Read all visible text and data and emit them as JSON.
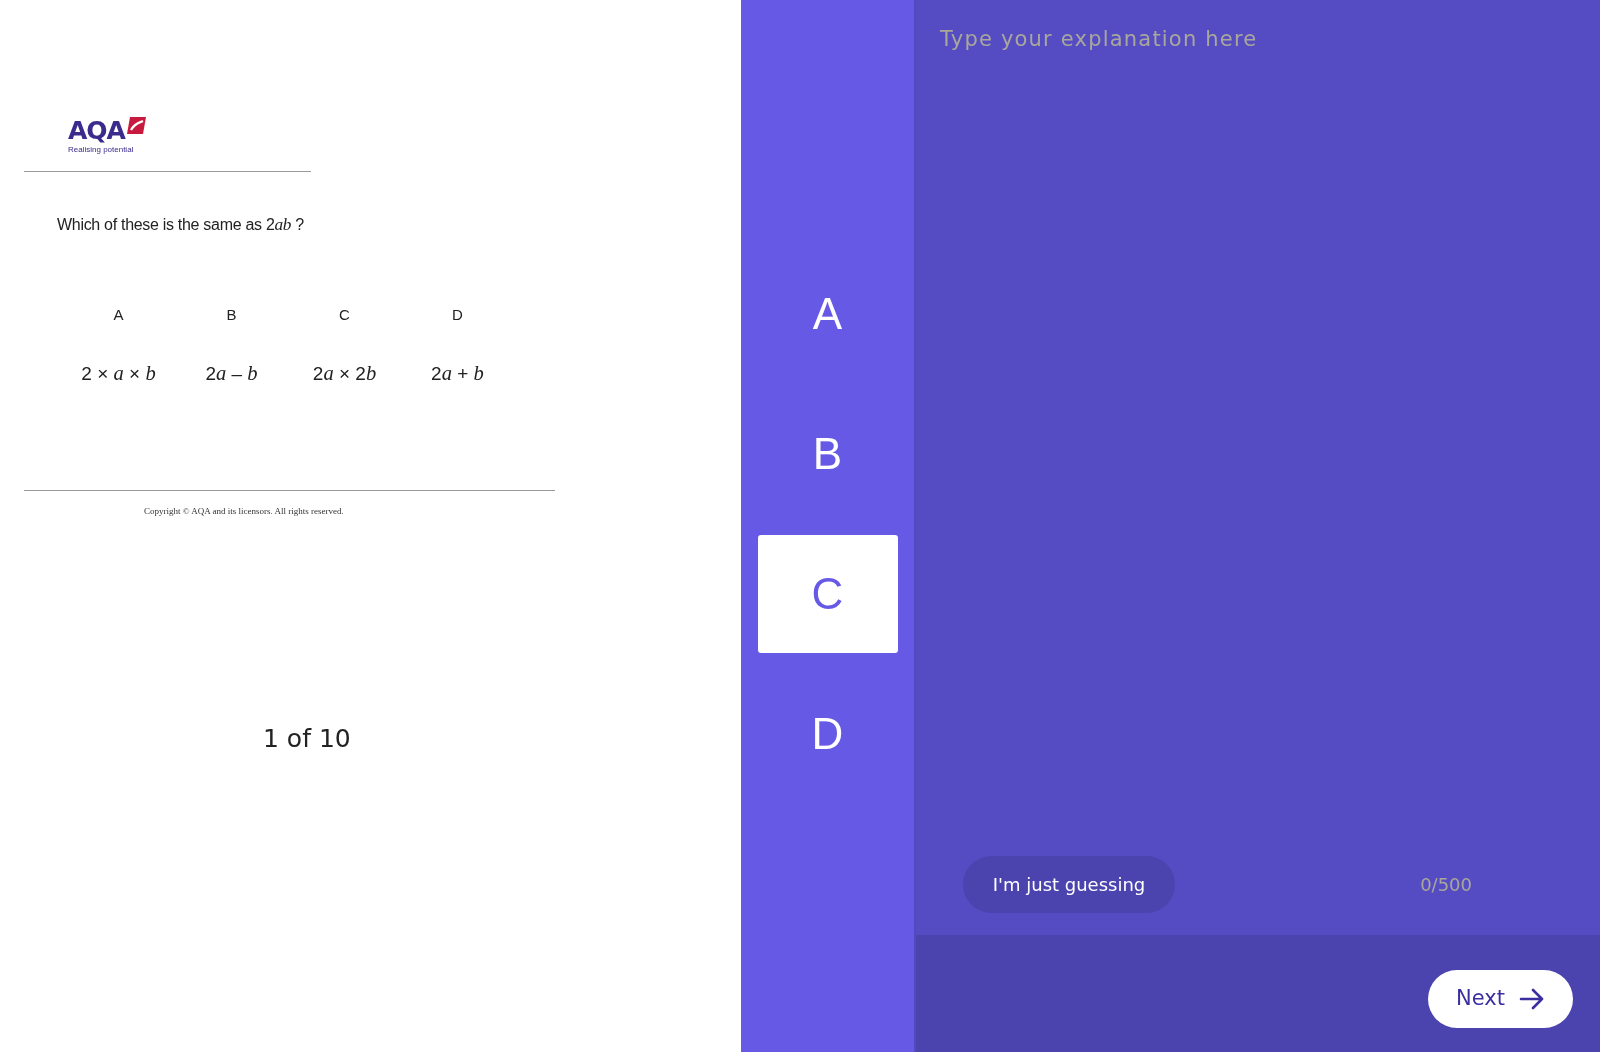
{
  "question_slide": {
    "logo": {
      "wordmark": "AQA",
      "tagline": "Realising potential"
    },
    "question": [
      {
        "text": "Which of these is the same as 2",
        "italic": false
      },
      {
        "text": "ab",
        "italic": true
      },
      {
        "text": " ?",
        "italic": false
      }
    ],
    "options": [
      {
        "letter": "A",
        "expression": [
          {
            "text": "2 × ",
            "italic": false
          },
          {
            "text": "a",
            "italic": true
          },
          {
            "text": " × ",
            "italic": false
          },
          {
            "text": "b",
            "italic": true
          }
        ]
      },
      {
        "letter": "B",
        "expression": [
          {
            "text": "2",
            "italic": false
          },
          {
            "text": "a",
            "italic": true
          },
          {
            "text": " – ",
            "italic": false
          },
          {
            "text": "b",
            "italic": true
          }
        ]
      },
      {
        "letter": "C",
        "expression": [
          {
            "text": "2",
            "italic": false
          },
          {
            "text": "a",
            "italic": true
          },
          {
            "text": " × 2",
            "italic": false
          },
          {
            "text": "b",
            "italic": true
          }
        ]
      },
      {
        "letter": "D",
        "expression": [
          {
            "text": "2",
            "italic": false
          },
          {
            "text": "a",
            "italic": true
          },
          {
            "text": " + ",
            "italic": false
          },
          {
            "text": "b",
            "italic": true
          }
        ]
      }
    ],
    "copyright": "Copyright © AQA and its licensors. All rights reserved."
  },
  "progress": "1 of 10",
  "answer_choices": [
    {
      "label": "A",
      "selected": false
    },
    {
      "label": "B",
      "selected": false
    },
    {
      "label": "C",
      "selected": true
    },
    {
      "label": "D",
      "selected": false
    }
  ],
  "explanation": {
    "placeholder": "Type your explanation here",
    "char_count": "0/500"
  },
  "guess_button": "I'm just guessing",
  "next_button": "Next"
}
